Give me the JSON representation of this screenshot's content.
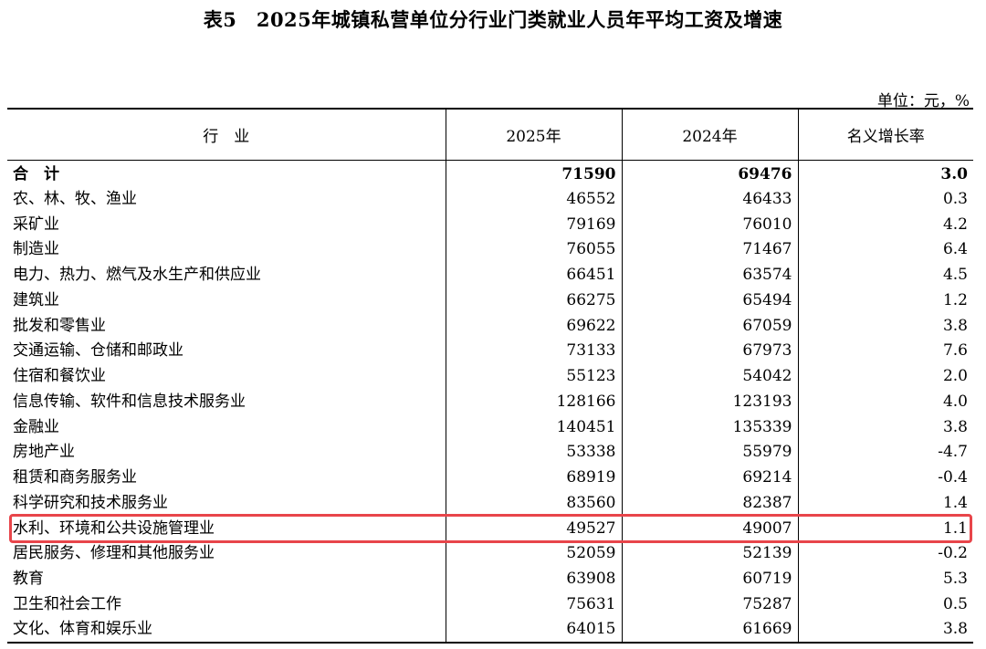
{
  "title": "表5　2025年城镇私营单位分行业门类就业人员年平均工资及增速",
  "unit": "单位：元，%",
  "columns": {
    "industry": "行　业",
    "y2025": "2025年",
    "y2024": "2024年",
    "growth": "名义增长率"
  },
  "rows": [
    {
      "industry": "合　计",
      "y2025": "71590",
      "y2024": "69476",
      "growth": "3.0"
    },
    {
      "industry": "农、林、牧、渔业",
      "y2025": "46552",
      "y2024": "46433",
      "growth": "0.3"
    },
    {
      "industry": "采矿业",
      "y2025": "79169",
      "y2024": "76010",
      "growth": "4.2"
    },
    {
      "industry": "制造业",
      "y2025": "76055",
      "y2024": "71467",
      "growth": "6.4"
    },
    {
      "industry": "电力、热力、燃气及水生产和供应业",
      "y2025": "66451",
      "y2024": "63574",
      "growth": "4.5"
    },
    {
      "industry": "建筑业",
      "y2025": "66275",
      "y2024": "65494",
      "growth": "1.2"
    },
    {
      "industry": "批发和零售业",
      "y2025": "69622",
      "y2024": "67059",
      "growth": "3.8"
    },
    {
      "industry": "交通运输、仓储和邮政业",
      "y2025": "73133",
      "y2024": "67973",
      "growth": "7.6"
    },
    {
      "industry": "住宿和餐饮业",
      "y2025": "55123",
      "y2024": "54042",
      "growth": "2.0"
    },
    {
      "industry": "信息传输、软件和信息技术服务业",
      "y2025": "128166",
      "y2024": "123193",
      "growth": "4.0"
    },
    {
      "industry": "金融业",
      "y2025": "140451",
      "y2024": "135339",
      "growth": "3.8"
    },
    {
      "industry": "房地产业",
      "y2025": "53338",
      "y2024": "55979",
      "growth": "-4.7"
    },
    {
      "industry": "租赁和商务服务业",
      "y2025": "68919",
      "y2024": "69214",
      "growth": "-0.4"
    },
    {
      "industry": "科学研究和技术服务业",
      "y2025": "83560",
      "y2024": "82387",
      "growth": "1.4"
    },
    {
      "industry": "水利、环境和公共设施管理业",
      "y2025": "49527",
      "y2024": "49007",
      "growth": "1.1"
    },
    {
      "industry": "居民服务、修理和其他服务业",
      "y2025": "52059",
      "y2024": "52139",
      "growth": "-0.2"
    },
    {
      "industry": "教育",
      "y2025": "63908",
      "y2024": "60719",
      "growth": "5.3"
    },
    {
      "industry": "卫生和社会工作",
      "y2025": "75631",
      "y2024": "75287",
      "growth": "0.5"
    },
    {
      "industry": "文化、体育和娱乐业",
      "y2025": "64015",
      "y2024": "61669",
      "growth": "3.8"
    }
  ],
  "highlight": {
    "row_index": 14,
    "color": "#e8454a"
  }
}
